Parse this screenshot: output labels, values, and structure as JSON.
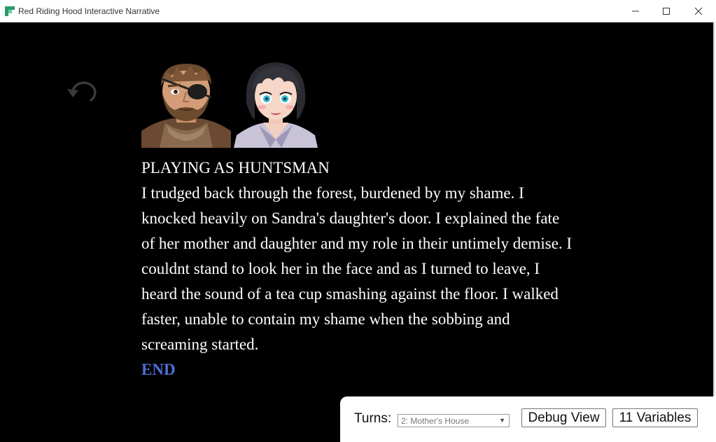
{
  "window": {
    "title": "Red Riding Hood Interactive Narrative",
    "icon": "app-icon",
    "controls": [
      "minimize-icon",
      "maximize-icon",
      "close-icon"
    ]
  },
  "game": {
    "undo_icon": "undo-icon",
    "portraits": [
      {
        "character": "huntsman"
      },
      {
        "character": "girl"
      }
    ],
    "playing_as": "PLAYING AS HUNTSMAN",
    "narrative": "I trudged back through the forest, burdened by my shame. I knocked heavily on Sandra's daughter's door. I explained the fate of her mother and daughter and my role in their untimely demise. I couldnt stand to look her in the face and as I turned to leave, I heard the sound of a tea cup smashing against the floor. I walked faster, unable to contain my shame when the sobbing and screaming started.",
    "end_label": "END"
  },
  "controls": {
    "turns_label": "Turns:",
    "turns_selected": "2: Mother's House",
    "debug_button": "Debug View",
    "variables_button": "11 Variables"
  },
  "colors": {
    "background": "#000000",
    "text": "#ffffff",
    "end_link": "#4d6fd6",
    "panel": "#ffffff"
  }
}
